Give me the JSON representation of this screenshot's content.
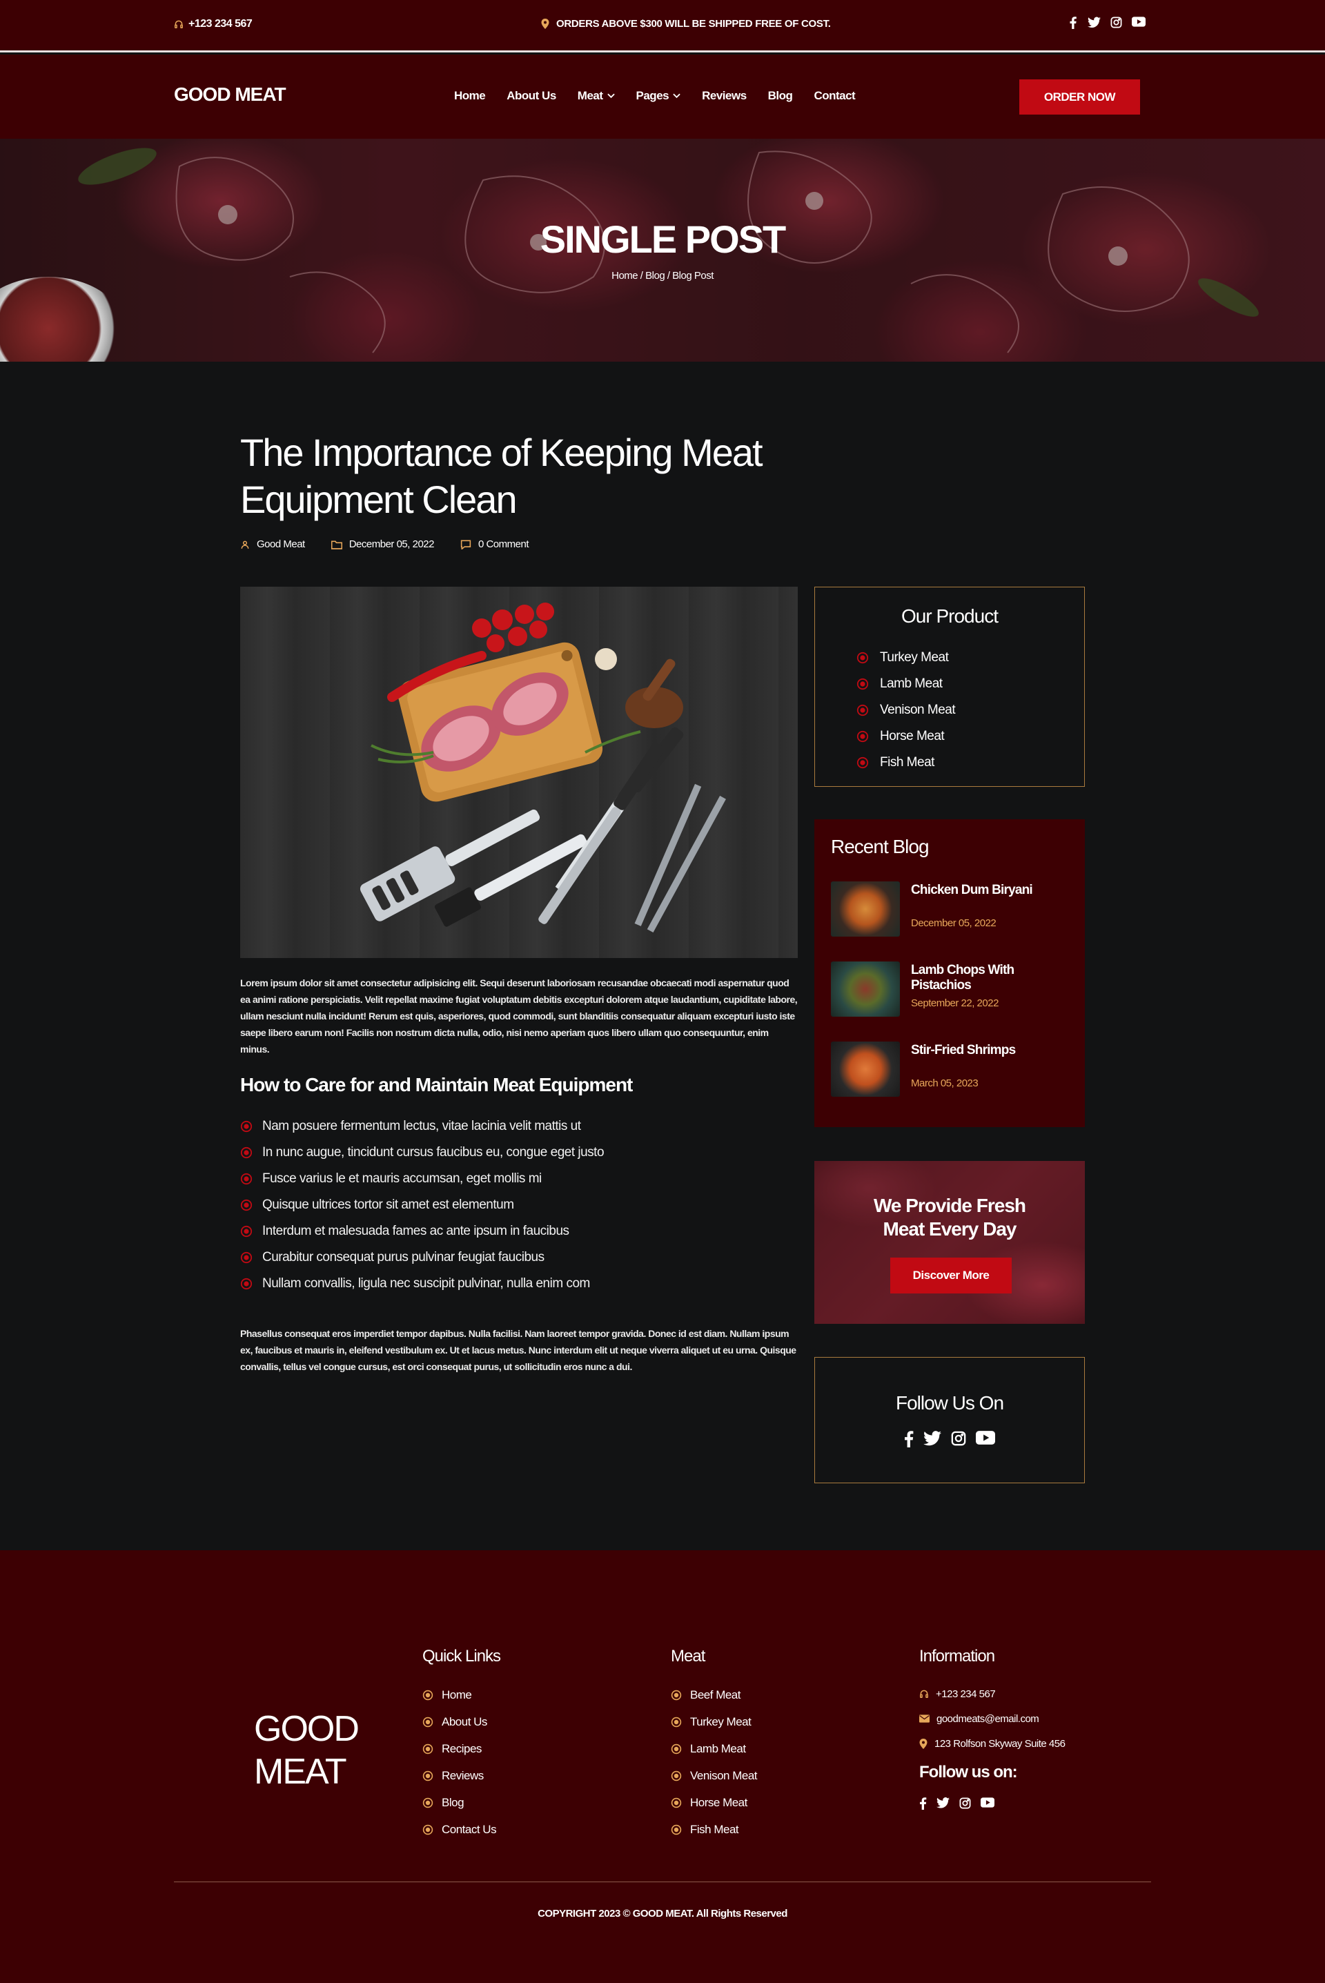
{
  "topbar": {
    "phone": "+123 234 567",
    "notice": "ORDERS ABOVE $300 WILL BE SHIPPED FREE OF COST.",
    "social_icons": [
      "facebook-icon",
      "twitter-icon",
      "instagram-icon",
      "youtube-icon"
    ]
  },
  "nav": {
    "logo": "GOOD MEAT",
    "items": [
      {
        "label": "Home"
      },
      {
        "label": "About Us"
      },
      {
        "label": "Meat"
      },
      {
        "label": "Pages"
      },
      {
        "label": "Reviews"
      },
      {
        "label": "Blog"
      },
      {
        "label": "Contact"
      }
    ],
    "order_button": "ORDER NOW"
  },
  "hero": {
    "title": "SINGLE POST",
    "breadcrumb": "Home / Blog / Blog Post"
  },
  "post": {
    "title": "The Importance of Keeping Meat Equipment Clean",
    "author": "Good Meat",
    "date": "December 05, 2022",
    "comments": "0 Comment",
    "paragraph1": "Lorem ipsum dolor sit amet consectetur adipisicing elit. Sequi deserunt laboriosam recusandae obcaecati modi aspernatur quod ea animi ratione perspiciatis. Velit repellat maxime fugiat voluptatum debitis excepturi dolorem atque laudantium, cupiditate labore, ullam nesciunt nulla incidunt! Rerum est quis, asperiores, quod commodi, sunt blanditiis consequatur aliquam excepturi iusto iste saepe libero earum non! Facilis non nostrum dicta nulla, odio, nisi nemo aperiam quos libero ullam quo consequuntur, enim minus.",
    "subheading": "How to Care for and Maintain Meat Equipment",
    "bullets": [
      "Nam posuere fermentum lectus, vitae lacinia velit mattis ut",
      "In nunc augue, tincidunt cursus faucibus eu, congue eget justo",
      "Fusce varius le et mauris accumsan, eget mollis mi",
      "Quisque ultrices tortor sit amet est elementum",
      "Interdum et malesuada fames ac ante ipsum in faucibus",
      "Curabitur consequat purus pulvinar feugiat faucibus",
      "Nullam convallis, ligula nec suscipit pulvinar, nulla enim com"
    ],
    "paragraph2": "Phasellus consequat eros imperdiet tempor dapibus. Nulla facilisi. Nam laoreet tempor gravida. Donec id est diam. Nullam ipsum ex, faucibus et mauris in, eleifend vestibulum ex. Ut et lacus metus. Nunc interdum elit ut neque viverra aliquet ut eu urna. Quisque convallis, tellus vel congue cursus, est orci consequat purus, ut sollicitudin eros nunc a dui."
  },
  "sidebar": {
    "product_title": "Our Product",
    "products": [
      {
        "label": "Turkey Meat"
      },
      {
        "label": "Lamb Meat"
      },
      {
        "label": "Venison Meat"
      },
      {
        "label": "Horse Meat"
      },
      {
        "label": "Fish Meat"
      }
    ],
    "recent_title": "Recent Blog",
    "recent": [
      {
        "title": "Chicken Dum Biryani",
        "date": "December 05, 2022"
      },
      {
        "title": "Lamb Chops With Pistachios",
        "date": "September 22, 2022"
      },
      {
        "title": "Stir-Fried Shrimps",
        "date": "March 05, 2023"
      }
    ],
    "promo_line1": "We Provide Fresh",
    "promo_line2": "Meat Every Day",
    "promo_button": "Discover More",
    "follow_title": "Follow Us On"
  },
  "footer": {
    "logo_line1": "GOOD",
    "logo_line2": "MEAT",
    "quick_title": "Quick Links",
    "quick_links": [
      {
        "label": "Home"
      },
      {
        "label": "About Us"
      },
      {
        "label": "Recipes"
      },
      {
        "label": "Reviews"
      },
      {
        "label": "Blog"
      },
      {
        "label": "Contact Us"
      }
    ],
    "meat_title": "Meat",
    "meat_links": [
      {
        "label": "Beef Meat"
      },
      {
        "label": "Turkey Meat"
      },
      {
        "label": "Lamb Meat"
      },
      {
        "label": "Venison Meat"
      },
      {
        "label": "Horse Meat"
      },
      {
        "label": "Fish Meat"
      }
    ],
    "info_title": "Information",
    "phone": "+123 234 567",
    "email": "goodmeats@email.com",
    "address": "123 Rolfson Skyway Suite 456",
    "follow_label": "Follow us on:",
    "copyright": "COPYRIGHT 2023 © GOOD MEAT. All Rights Reserved"
  },
  "colors": {
    "maroon": "#3d0003",
    "accent_red": "#c10a13",
    "gold": "#e7a75a",
    "body_bg": "#121314"
  }
}
